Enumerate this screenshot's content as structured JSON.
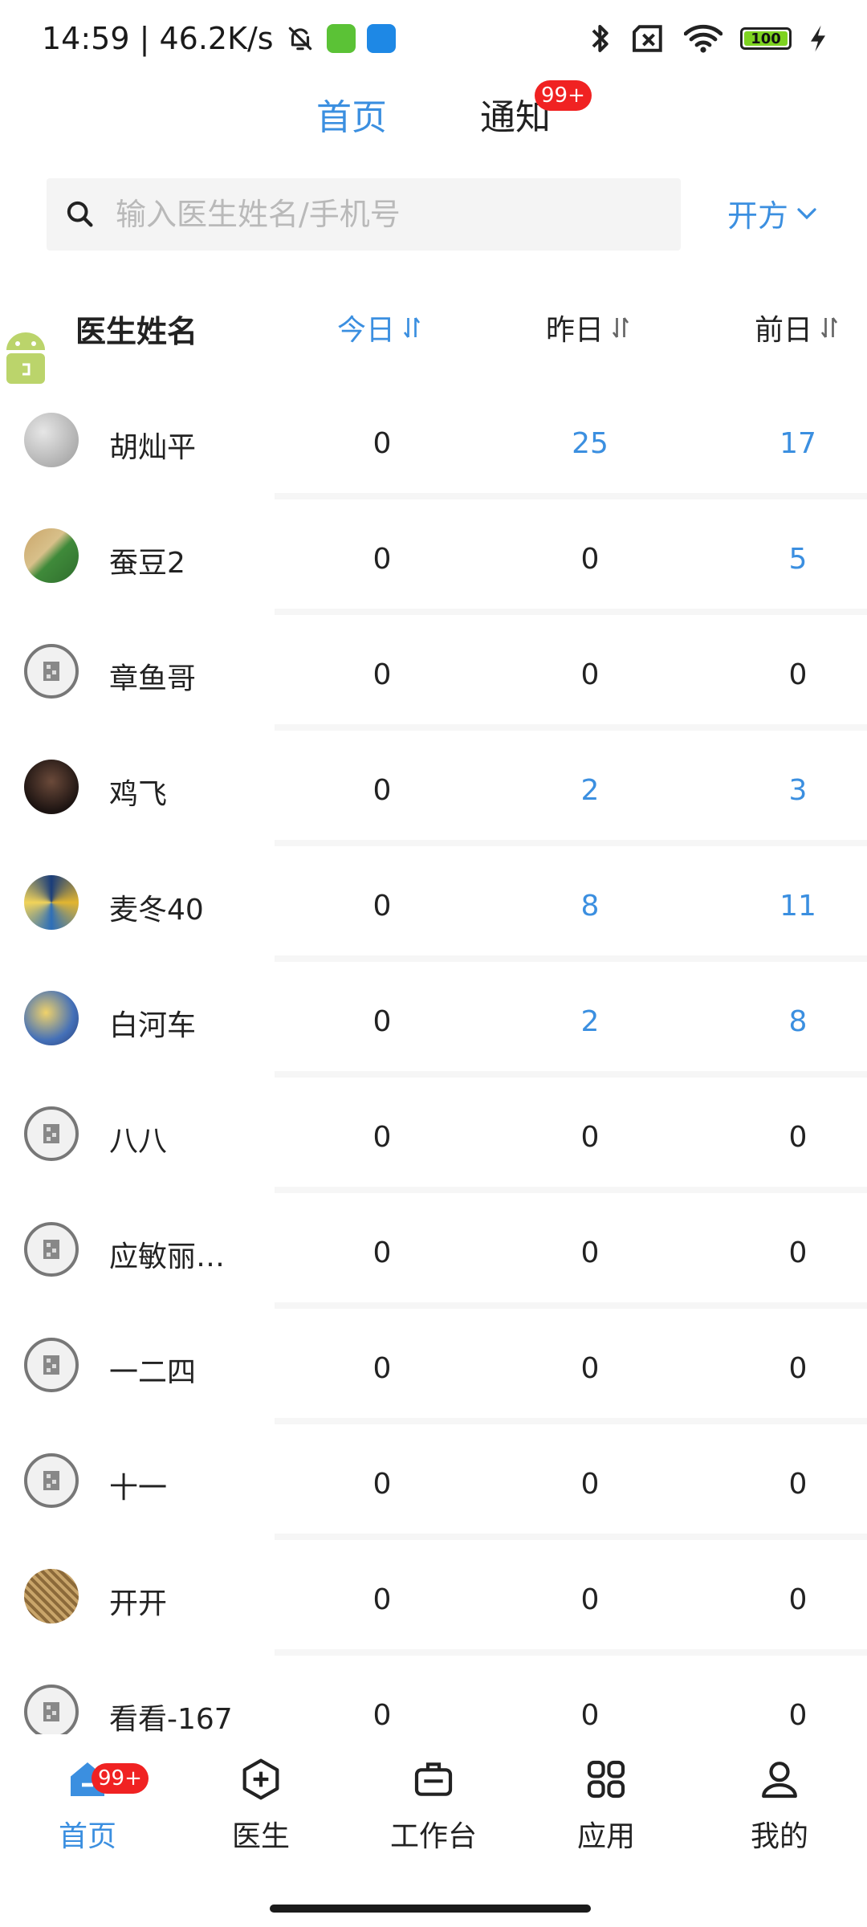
{
  "status_bar": {
    "time_speed": "14:59 | 46.2K/s",
    "battery_level": "100",
    "battery_fraction": 1.0
  },
  "top_tabs": [
    {
      "label": "首页",
      "active": true
    },
    {
      "label": "通知",
      "active": false,
      "badge": "99+"
    }
  ],
  "search": {
    "placeholder": "输入医生姓名/手机号",
    "value": ""
  },
  "prescribe_dropdown": {
    "label": "开方"
  },
  "table": {
    "headers": {
      "name": "医生姓名",
      "today": "今日",
      "yesterday": "昨日",
      "day_before": "前日"
    },
    "rows": [
      {
        "name": "胡灿平",
        "today": "0",
        "yesterday": "25",
        "day_before": "17",
        "avatar": "gray-photo"
      },
      {
        "name": "蚕豆2",
        "today": "0",
        "yesterday": "0",
        "day_before": "5",
        "avatar": "green-photo"
      },
      {
        "name": "章鱼哥",
        "today": "0",
        "yesterday": "0",
        "day_before": "0",
        "avatar": "placeholder"
      },
      {
        "name": "鸡飞",
        "today": "0",
        "yesterday": "2",
        "day_before": "3",
        "avatar": "doll-photo"
      },
      {
        "name": "麦冬40",
        "today": "0",
        "yesterday": "8",
        "day_before": "11",
        "avatar": "colorful-photo"
      },
      {
        "name": "白河车",
        "today": "0",
        "yesterday": "2",
        "day_before": "8",
        "avatar": "painting-photo"
      },
      {
        "name": "八八",
        "today": "0",
        "yesterday": "0",
        "day_before": "0",
        "avatar": "placeholder"
      },
      {
        "name": "应敏丽…",
        "today": "0",
        "yesterday": "0",
        "day_before": "0",
        "avatar": "placeholder"
      },
      {
        "name": "一二四",
        "today": "0",
        "yesterday": "0",
        "day_before": "0",
        "avatar": "placeholder"
      },
      {
        "name": "十一",
        "today": "0",
        "yesterday": "0",
        "day_before": "0",
        "avatar": "placeholder"
      },
      {
        "name": "开开",
        "today": "0",
        "yesterday": "0",
        "day_before": "0",
        "avatar": "noodle-photo"
      },
      {
        "name": "看看-167",
        "today": "0",
        "yesterday": "0",
        "day_before": "0",
        "avatar": "placeholder"
      }
    ]
  },
  "bottom_nav": [
    {
      "label": "首页",
      "icon": "home-icon",
      "active": true,
      "badge": "99+"
    },
    {
      "label": "医生",
      "icon": "plus-circle-icon",
      "active": false
    },
    {
      "label": "工作台",
      "icon": "briefcase-icon",
      "active": false
    },
    {
      "label": "应用",
      "icon": "apps-grid-icon",
      "active": false
    },
    {
      "label": "我的",
      "icon": "user-icon",
      "active": false
    }
  ],
  "colors": {
    "accent": "#3b8fe0",
    "badge": "#f02222",
    "text": "#222222",
    "placeholder": "#b9b9b9"
  }
}
